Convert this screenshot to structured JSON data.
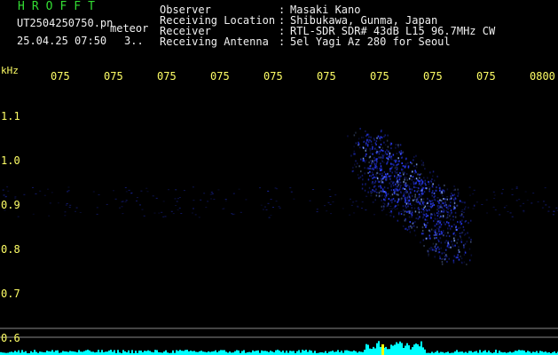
{
  "header": {
    "logo": "HROFFT",
    "filename": "UT2504250750.pn",
    "meteor_label": "meteor",
    "datetime": "25.04.25 07:50",
    "count": "3..",
    "fields": [
      {
        "label": "Observer",
        "sep": ":",
        "value": "Masaki Kano"
      },
      {
        "label": "Receiving Location",
        "sep": ":",
        "value": "Shibukawa, Gunma, Japan"
      },
      {
        "label": "Receiver",
        "sep": ":",
        "value": "RTL-SDR SDR# 43dB L15 96.7MHz CW"
      },
      {
        "label": "Receiving Antenna",
        "sep": ":",
        "value": "5el Yagi Az 280 for Seoul"
      }
    ]
  },
  "axis": {
    "unit": "kHz",
    "time_labels": [
      "075",
      "075",
      "075",
      "075",
      "075",
      "075",
      "075",
      "075",
      "075",
      "0800"
    ],
    "freq_labels": [
      "1.1",
      "1.0",
      "0.9",
      "0.8",
      "0.7",
      "0.6"
    ]
  },
  "colors": {
    "text": "#f0f0f0",
    "axis": "#ffff66",
    "logo": "#33dd33",
    "signal": "#2a3cff",
    "spectrum": "#00ffff",
    "bar": "#ffff00"
  }
}
